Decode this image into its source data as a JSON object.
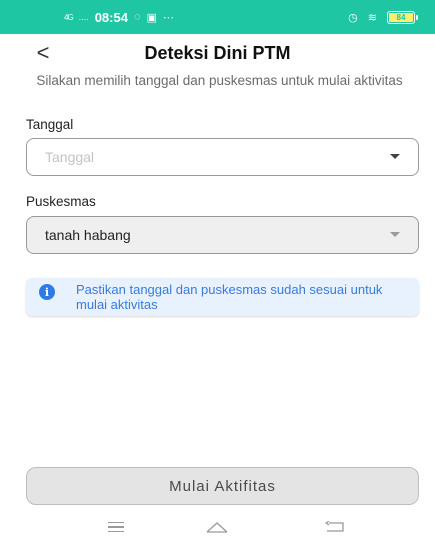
{
  "status_bar": {
    "signal": "4G",
    "dots": "....",
    "time": "08:54",
    "extra": "⋯",
    "battery": "84"
  },
  "header": {
    "back": "<",
    "title": "Deteksi Dini PTM"
  },
  "subtitle": "Silakan memilih tanggal dan puskesmas untuk mulai aktivitas",
  "form": {
    "date_label": "Tanggal",
    "date_placeholder": "Tanggal",
    "puskesmas_label": "Puskesmas",
    "puskesmas_value": "tanah habang"
  },
  "info": {
    "icon": "i",
    "text": "Pastikan tanggal dan puskesmas sudah sesuai untuk mulai aktivitas"
  },
  "cta": {
    "label": "Mulai Aktifitas"
  },
  "icons": {
    "back": "chevron-left-icon",
    "dropdown": "caret-down-icon",
    "info": "info-icon",
    "nav_menu": "menu-icon",
    "nav_home": "home-icon",
    "nav_back": "back-icon"
  },
  "colors": {
    "status_bar": "#1fc6a4",
    "info_bg": "#e8f2ff",
    "info_text": "#3a7ad9",
    "button_bg": "#e4e4e4"
  }
}
